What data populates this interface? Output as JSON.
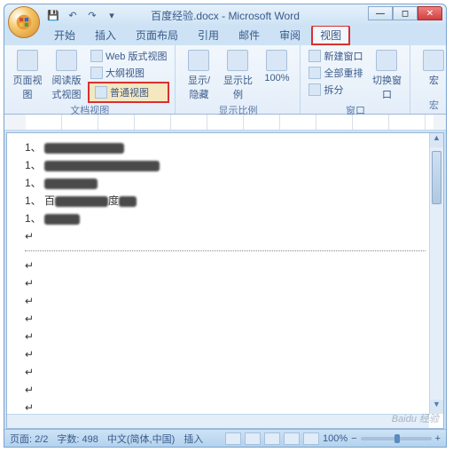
{
  "title": "百度经验.docx - Microsoft Word",
  "qat": {
    "save": "💾",
    "undo": "↶",
    "redo": "↷"
  },
  "tabs": [
    "开始",
    "插入",
    "页面布局",
    "引用",
    "邮件",
    "审阅",
    "视图"
  ],
  "active_tab_index": 6,
  "ribbon": {
    "group1": {
      "label": "文档视图",
      "page_view": "页面视图",
      "reading_view": "阅读版式视图",
      "web_view": "Web 版式视图",
      "outline_view": "大纲视图",
      "normal_view": "普通视图"
    },
    "group2": {
      "label": "显示比例",
      "show_hide": "显示/隐藏",
      "zoom": "显示比例",
      "hundred": "100%"
    },
    "group3": {
      "label": "窗口",
      "new_window": "新建窗口",
      "arrange_all": "全部重排",
      "split": "拆分",
      "switch_window": "切换窗口"
    },
    "group4": {
      "label": "宏",
      "macros": "宏"
    }
  },
  "document": {
    "lines": [
      "1、",
      "1、",
      "1、",
      "1、",
      "1、",
      "",
      "",
      "",
      "",
      "",
      "",
      "",
      "",
      "",
      "",
      "",
      ""
    ]
  },
  "statusbar": {
    "page": "页面: 2/2",
    "words": "字数: 498",
    "lang": "中文(简体,中国)",
    "insert": "插入",
    "zoom": "100%",
    "minus": "−",
    "plus": "+"
  },
  "watermark": "Baidu 经验"
}
